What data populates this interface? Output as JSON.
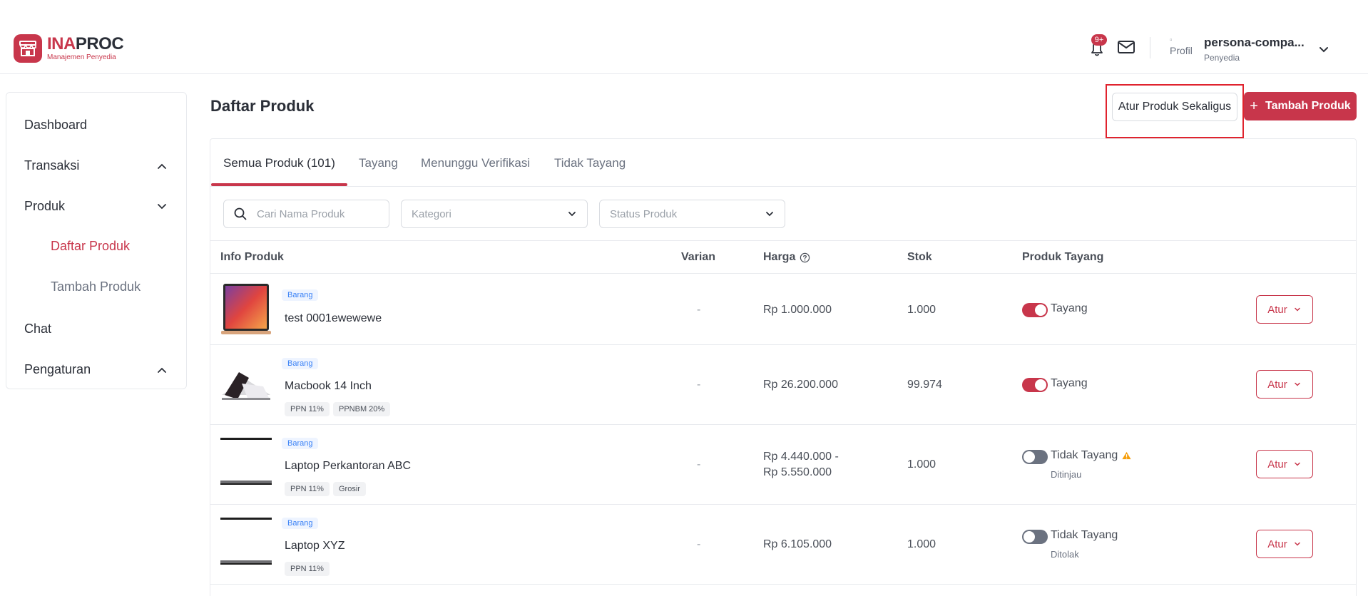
{
  "header": {
    "logo_title_prefix": "INA",
    "logo_title_suffix": "PROC",
    "logo_subtitle": "Manajemen Penyedia",
    "notification_count": "9+",
    "avatar_alt": "Profil",
    "user_name": "persona-compa...",
    "user_role": "Penyedia"
  },
  "sidebar": {
    "items": [
      {
        "label": "Dashboard"
      },
      {
        "label": "Transaksi"
      },
      {
        "label": "Produk"
      },
      {
        "label": "Daftar Produk"
      },
      {
        "label": "Tambah Produk"
      },
      {
        "label": "Chat"
      },
      {
        "label": "Pengaturan"
      }
    ]
  },
  "main": {
    "title": "Daftar Produk",
    "bulk_button": "Atur Produk Sekaligus",
    "add_button": "Tambah Produk",
    "tabs": [
      {
        "label": "Semua Produk (101)"
      },
      {
        "label": "Tayang"
      },
      {
        "label": "Menunggu Verifikasi"
      },
      {
        "label": "Tidak Tayang"
      }
    ],
    "filters": {
      "search_placeholder": "Cari Nama Produk",
      "category_placeholder": "Kategori",
      "status_placeholder": "Status Produk"
    },
    "columns": {
      "info": "Info Produk",
      "variant": "Varian",
      "price": "Harga",
      "stock": "Stok",
      "published": "Produk Tayang"
    },
    "rows": [
      {
        "type": "Barang",
        "name": "test 0001ewewewe",
        "tags": [],
        "variant": "-",
        "price": "Rp 1.000.000",
        "price2": "",
        "stock": "1.000",
        "published": true,
        "status": "Tayang",
        "status_sub": "",
        "action": "Atur"
      },
      {
        "type": "Barang",
        "name": "Macbook 14 Inch",
        "tags": [
          "PPN 11%",
          "PPNBM 20%"
        ],
        "variant": "-",
        "price": "Rp 26.200.000",
        "price2": "",
        "stock": "99.974",
        "published": true,
        "status": "Tayang",
        "status_sub": "",
        "action": "Atur"
      },
      {
        "type": "Barang",
        "name": "Laptop Perkantoran ABC",
        "tags": [
          "PPN 11%",
          "Grosir"
        ],
        "variant": "-",
        "price": "Rp 4.440.000 -",
        "price2": "Rp 5.550.000",
        "stock": "1.000",
        "published": false,
        "status": "Tidak Tayang",
        "status_sub": "Ditinjau",
        "action": "Atur"
      },
      {
        "type": "Barang",
        "name": "Laptop XYZ",
        "tags": [
          "PPN 11%"
        ],
        "variant": "-",
        "price": "Rp 6.105.000",
        "price2": "",
        "stock": "1.000",
        "published": false,
        "status": "Tidak Tayang",
        "status_sub": "Ditolak",
        "action": "Atur"
      }
    ]
  },
  "colors": {
    "brand": "#c8364b",
    "highlight": "#e0232e",
    "warning": "#f59e0b"
  }
}
